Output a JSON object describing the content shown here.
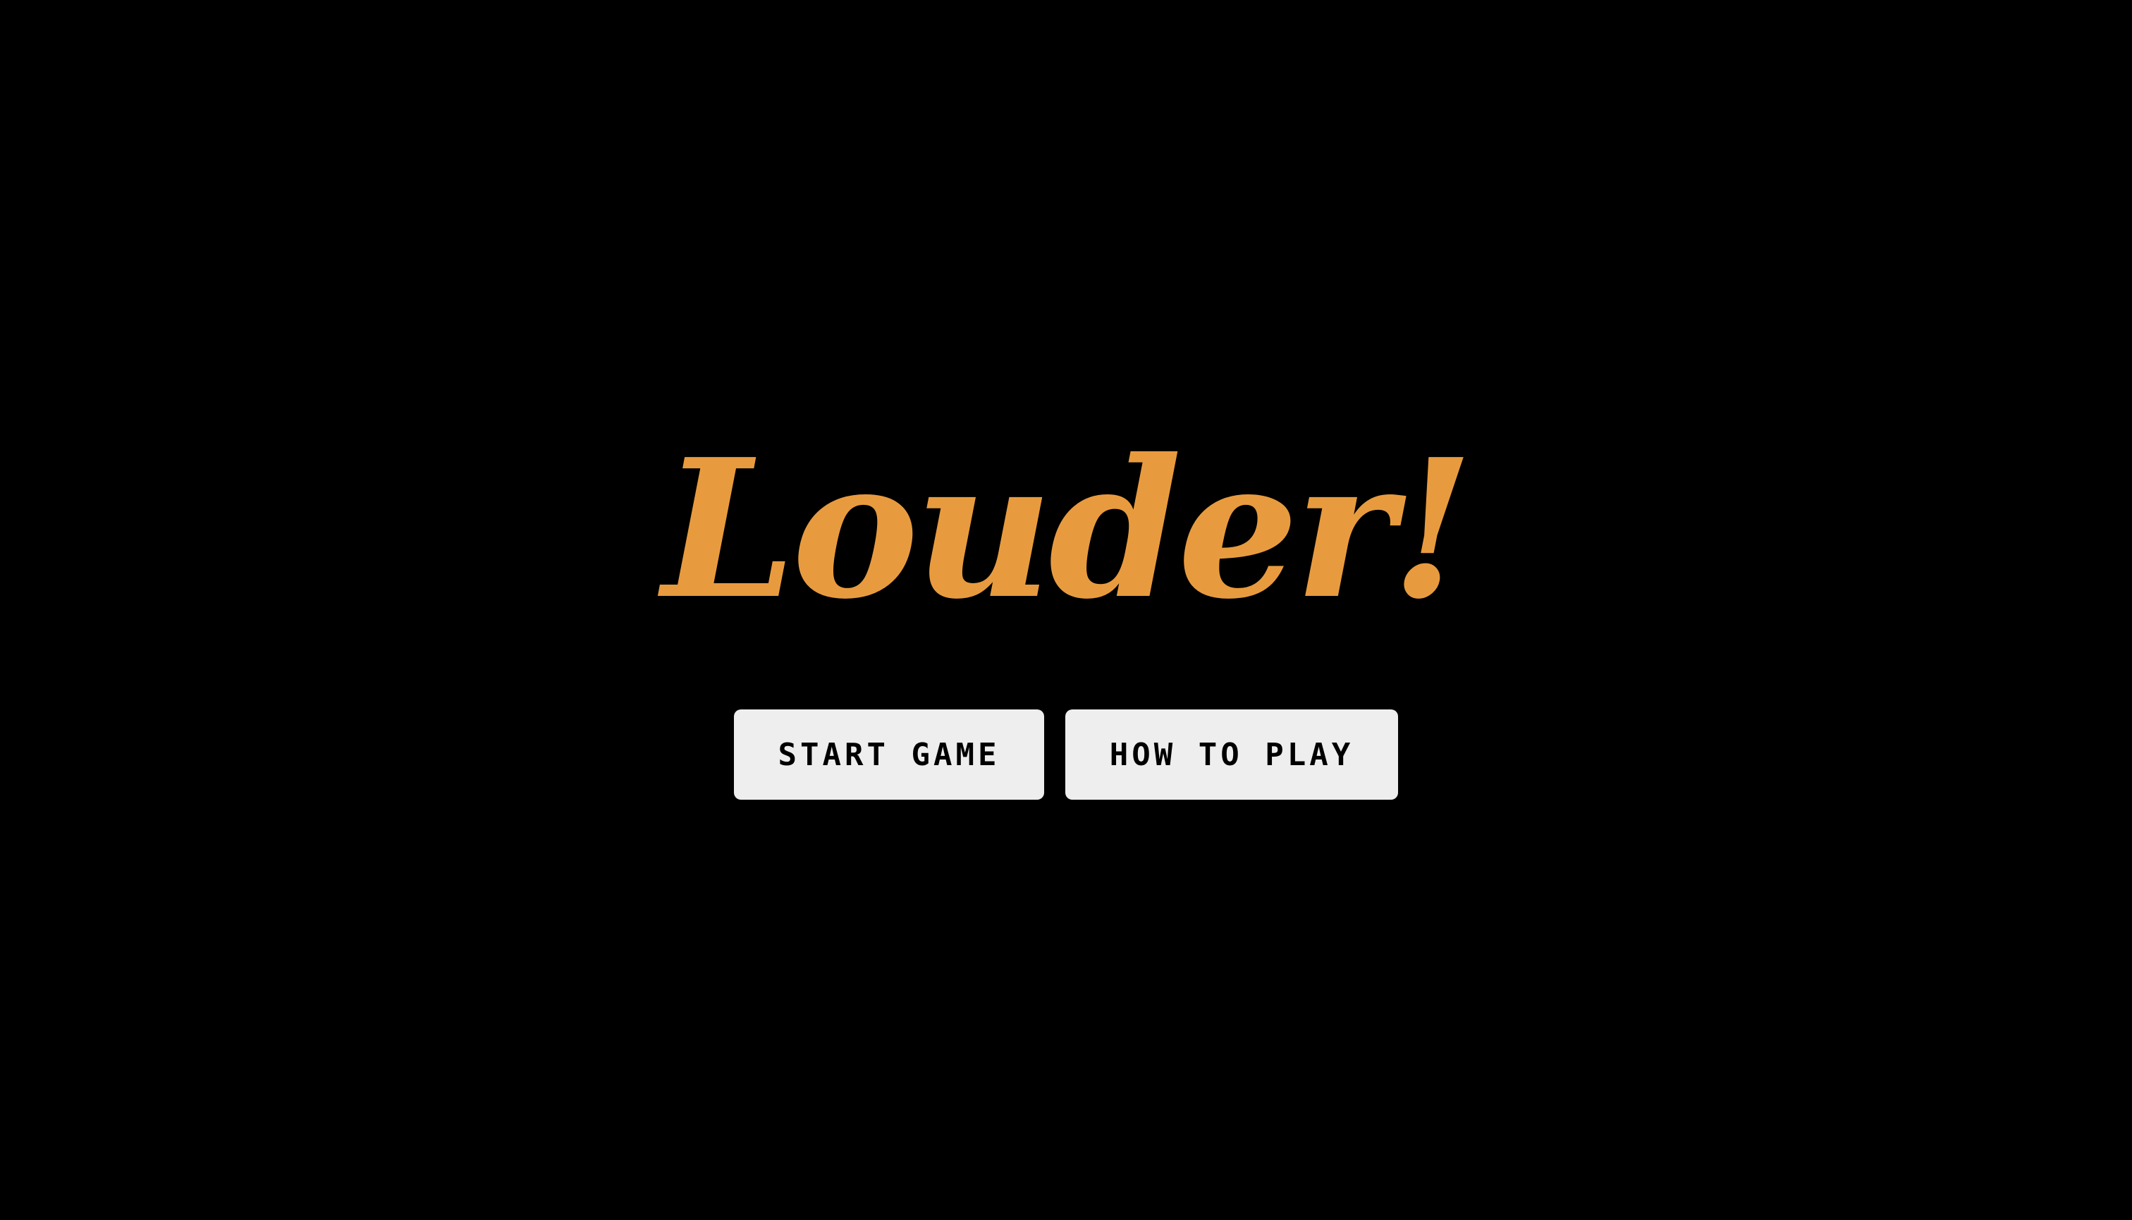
{
  "game": {
    "title": "Louder!",
    "title_color": "#E89B3E",
    "background_color": "#000000"
  },
  "menu": {
    "buttons": [
      {
        "label": "START GAME"
      },
      {
        "label": "HOW TO PLAY"
      }
    ],
    "button_background": "#EEEEEE",
    "button_text_color": "#000000"
  }
}
